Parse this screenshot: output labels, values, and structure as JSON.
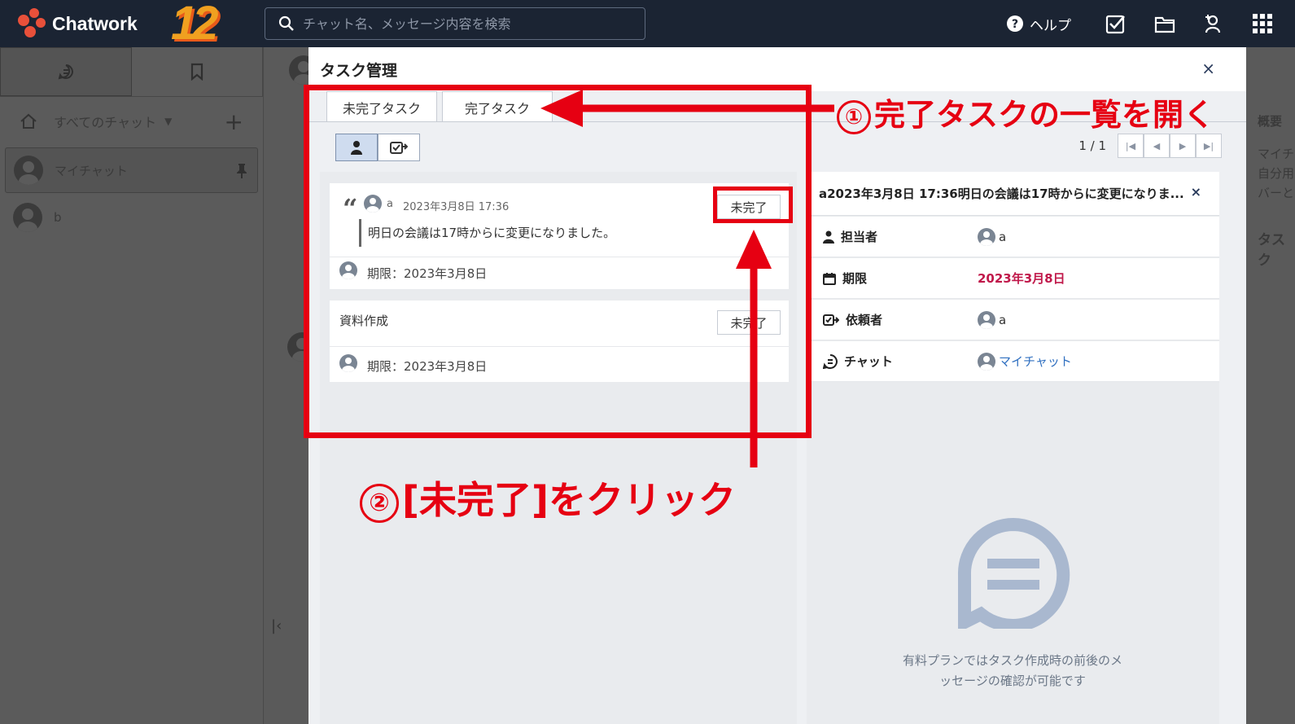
{
  "app": {
    "brand": "Chatwork",
    "badge": "12",
    "search_placeholder": "チャット名、メッセージ内容を検索",
    "help_label": "ヘルプ"
  },
  "sidebar": {
    "filter_label": "すべてのチャット",
    "rooms": [
      {
        "name": "マイチャット"
      },
      {
        "name": "b"
      }
    ]
  },
  "right_panel_peek": {
    "lines": [
      "概要",
      "マイチ",
      "自分用",
      "バーと",
      "タスク"
    ]
  },
  "modal": {
    "title": "タスク管理",
    "close": "×",
    "tabs": [
      {
        "label": "未完了タスク"
      },
      {
        "label": "完了タスク"
      }
    ],
    "pager": "1 / 1",
    "tasks": [
      {
        "author": "a",
        "timestamp": "2023年3月8日 17:36",
        "body": "明日の会議は17時からに変更になりました。",
        "due": "期限：2023年3月8日",
        "button": "未完了"
      },
      {
        "title": "資料作成",
        "due": "期限：2023年3月8日",
        "button": "未完了"
      }
    ],
    "detail": {
      "title": "a2023年3月8日 17:36明日の会議は17時からに変更になりま...",
      "close": "×",
      "rows": [
        {
          "label": "担当者",
          "value": "a"
        },
        {
          "label": "期限",
          "value": "2023年3月8日"
        },
        {
          "label": "依頼者",
          "value": "a"
        },
        {
          "label": "チャット",
          "value": "マイチャット"
        }
      ],
      "promo_line1": "有料プランではタスク作成時の前後のメ",
      "promo_line2": "ッセージの確認が可能です"
    }
  },
  "annotations": {
    "step1_num": "①",
    "step1": "完了タスクの一覧を開く",
    "step2_num": "②",
    "step2": "[未完了]をクリック",
    "color": "#e60012"
  }
}
